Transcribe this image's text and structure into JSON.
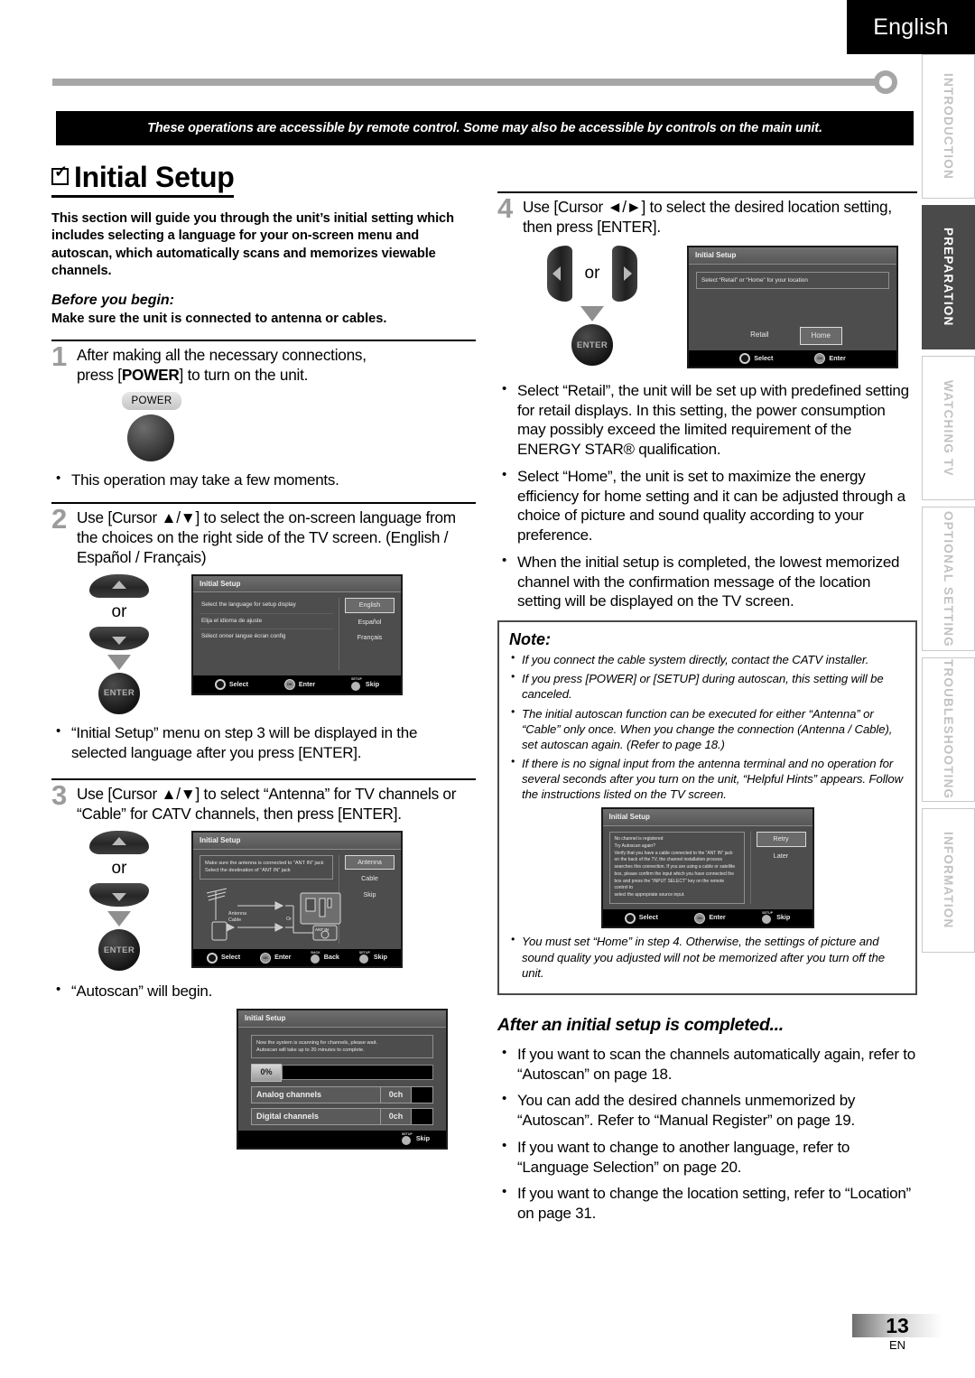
{
  "header": {
    "language_tab": "English",
    "banner": "These operations are accessible by remote control. Some may also be accessible by controls on the main unit."
  },
  "side_tabs": [
    {
      "label": "INTRODUCTION",
      "active": false
    },
    {
      "label": "PREPARATION",
      "active": true
    },
    {
      "label": "WATCHING TV",
      "active": false
    },
    {
      "label": "OPTIONAL SETTING",
      "active": false
    },
    {
      "label": "TROUBLESHOOTING",
      "active": false
    },
    {
      "label": "INFORMATION",
      "active": false
    }
  ],
  "section": {
    "title": "Initial Setup",
    "intro": "This section will guide you through the unit’s initial setting which includes selecting a language for your on-screen menu and autoscan, which automatically scans and memorizes viewable channels.",
    "before_heading": "Before you begin:",
    "before_body": "Make sure the unit is connected to antenna or cables."
  },
  "steps": {
    "one": {
      "num": "1",
      "text_a": "After making all the necessary connections,",
      "text_b": "press [",
      "text_key": "POWER",
      "text_c": "] to turn on the unit.",
      "power_label": "POWER",
      "bullet": "This operation may take a few moments."
    },
    "two": {
      "num": "2",
      "text": "Use [Cursor ▲/▼] to select the on-screen language from the choices on the right side of the TV screen. (English / Español / Français)",
      "or_label": "or",
      "enter_label": "ENTER",
      "bullet": "“Initial Setup” menu on step 3 will be displayed in the selected language after you press [ENTER]."
    },
    "three": {
      "num": "3",
      "text": "Use [Cursor ▲/▼] to select “Antenna” for TV channels or “Cable” for CATV channels, then press [ENTER].",
      "or_label": "or",
      "enter_label": "ENTER",
      "bullet": "“Autoscan” will begin."
    },
    "four": {
      "num": "4",
      "text": "Use [Cursor ◄/►] to select the desired location setting, then press [ENTER].",
      "or_label": "or",
      "enter_label": "ENTER",
      "bullets": [
        "Select “Retail”, the unit will be set up with predefined setting for retail displays. In this setting, the power consumption may possibly exceed the limited requirement of the ENERGY STAR® qualification.",
        "Select “Home”, the unit is set to maximize the energy efficiency for home setting and it can be adjusted through a choice of picture and sound quality according to your preference.",
        "When the initial setup is completed, the lowest memorized channel with the confirmation message of the location setting will be displayed on the TV screen."
      ]
    }
  },
  "osd_language": {
    "title": "Initial Setup",
    "rows": [
      "Select the language for setup display",
      "Elija el idioma de ajuste",
      "Sélect onner langue écran config"
    ],
    "options": [
      "English",
      "Español",
      "Français"
    ],
    "selected": "English",
    "footer": [
      "Select",
      "Enter",
      "Skip"
    ]
  },
  "osd_antenna": {
    "title": "Initial Setup",
    "notes": [
      "Make sure the antenna is connected to “ANT IN” jack",
      "Select the destination of “ANT IN” jack"
    ],
    "diagram_labels": [
      "Antenna",
      "Cable",
      "Or",
      "ANT IN"
    ],
    "options": [
      "Antenna",
      "Cable",
      "Skip"
    ],
    "selected": "Antenna",
    "footer": [
      "Select",
      "Enter",
      "Back",
      "Skip"
    ]
  },
  "osd_autoscan": {
    "title": "Initial Setup",
    "notes": [
      "Now the system is scanning for channels, please wait.",
      "Autoscan will take up to 20 minutes to complete."
    ],
    "progress": "0%",
    "counters": [
      {
        "label": "Analog channels",
        "value": "0ch"
      },
      {
        "label": "Digital channels",
        "value": "0ch"
      }
    ],
    "footer": [
      "Skip"
    ]
  },
  "osd_location": {
    "title": "Initial Setup",
    "prompt": "Select “Retail” or “Home” for your location",
    "options": [
      "Retail",
      "Home"
    ],
    "selected": "Home",
    "footer": [
      "Select",
      "Enter"
    ]
  },
  "osd_helpful": {
    "title": "Initial Setup",
    "lines": [
      "No channel is registered",
      "Try Autoscan again?",
      "Verify that you have a cable connected to the “ANT IN” jack",
      "on the back of the TV, the channel installation process",
      "searches this connection. If you are using a cable or satellite",
      "box, please confirm the input which you have connected the",
      "box and press the “INPUT SELECT” key on the remote control to",
      "select the appropriate source input."
    ],
    "options": [
      "Retry",
      "Later"
    ],
    "selected": "Retry",
    "footer": [
      "Select",
      "Enter",
      "Skip"
    ]
  },
  "note": {
    "heading": "Note:",
    "items": [
      "If you connect the cable system directly, contact the CATV installer.",
      "If you press  [POWER] or [SETUP] during autoscan, this setting will be canceled.",
      "The initial autoscan function can be executed for either “Antenna” or “Cable” only once. When you change the connection (Antenna / Cable), set autoscan again. (Refer to page 18.)",
      "If there is no signal input from the antenna terminal and no operation for several seconds after you turn on the unit, “Helpful Hints” appears. Follow the instructions listed on the TV screen.",
      "You must set “Home” in step 4. Otherwise, the settings of picture and sound quality you adjusted will not be memorized after you turn off the unit."
    ]
  },
  "after": {
    "heading": "After an initial setup is completed...",
    "items": [
      "If you want to scan the channels automatically again, refer to “Autoscan” on page 18.",
      "You can add the desired channels unmemorized by “Autoscan”. Refer to “Manual Register” on page 19.",
      "If you want to change to another language, refer to “Language Selection” on page 20.",
      "If you want to change the location setting, refer to “Location” on page 31."
    ]
  },
  "footer": {
    "page": "13",
    "lang": "EN"
  }
}
